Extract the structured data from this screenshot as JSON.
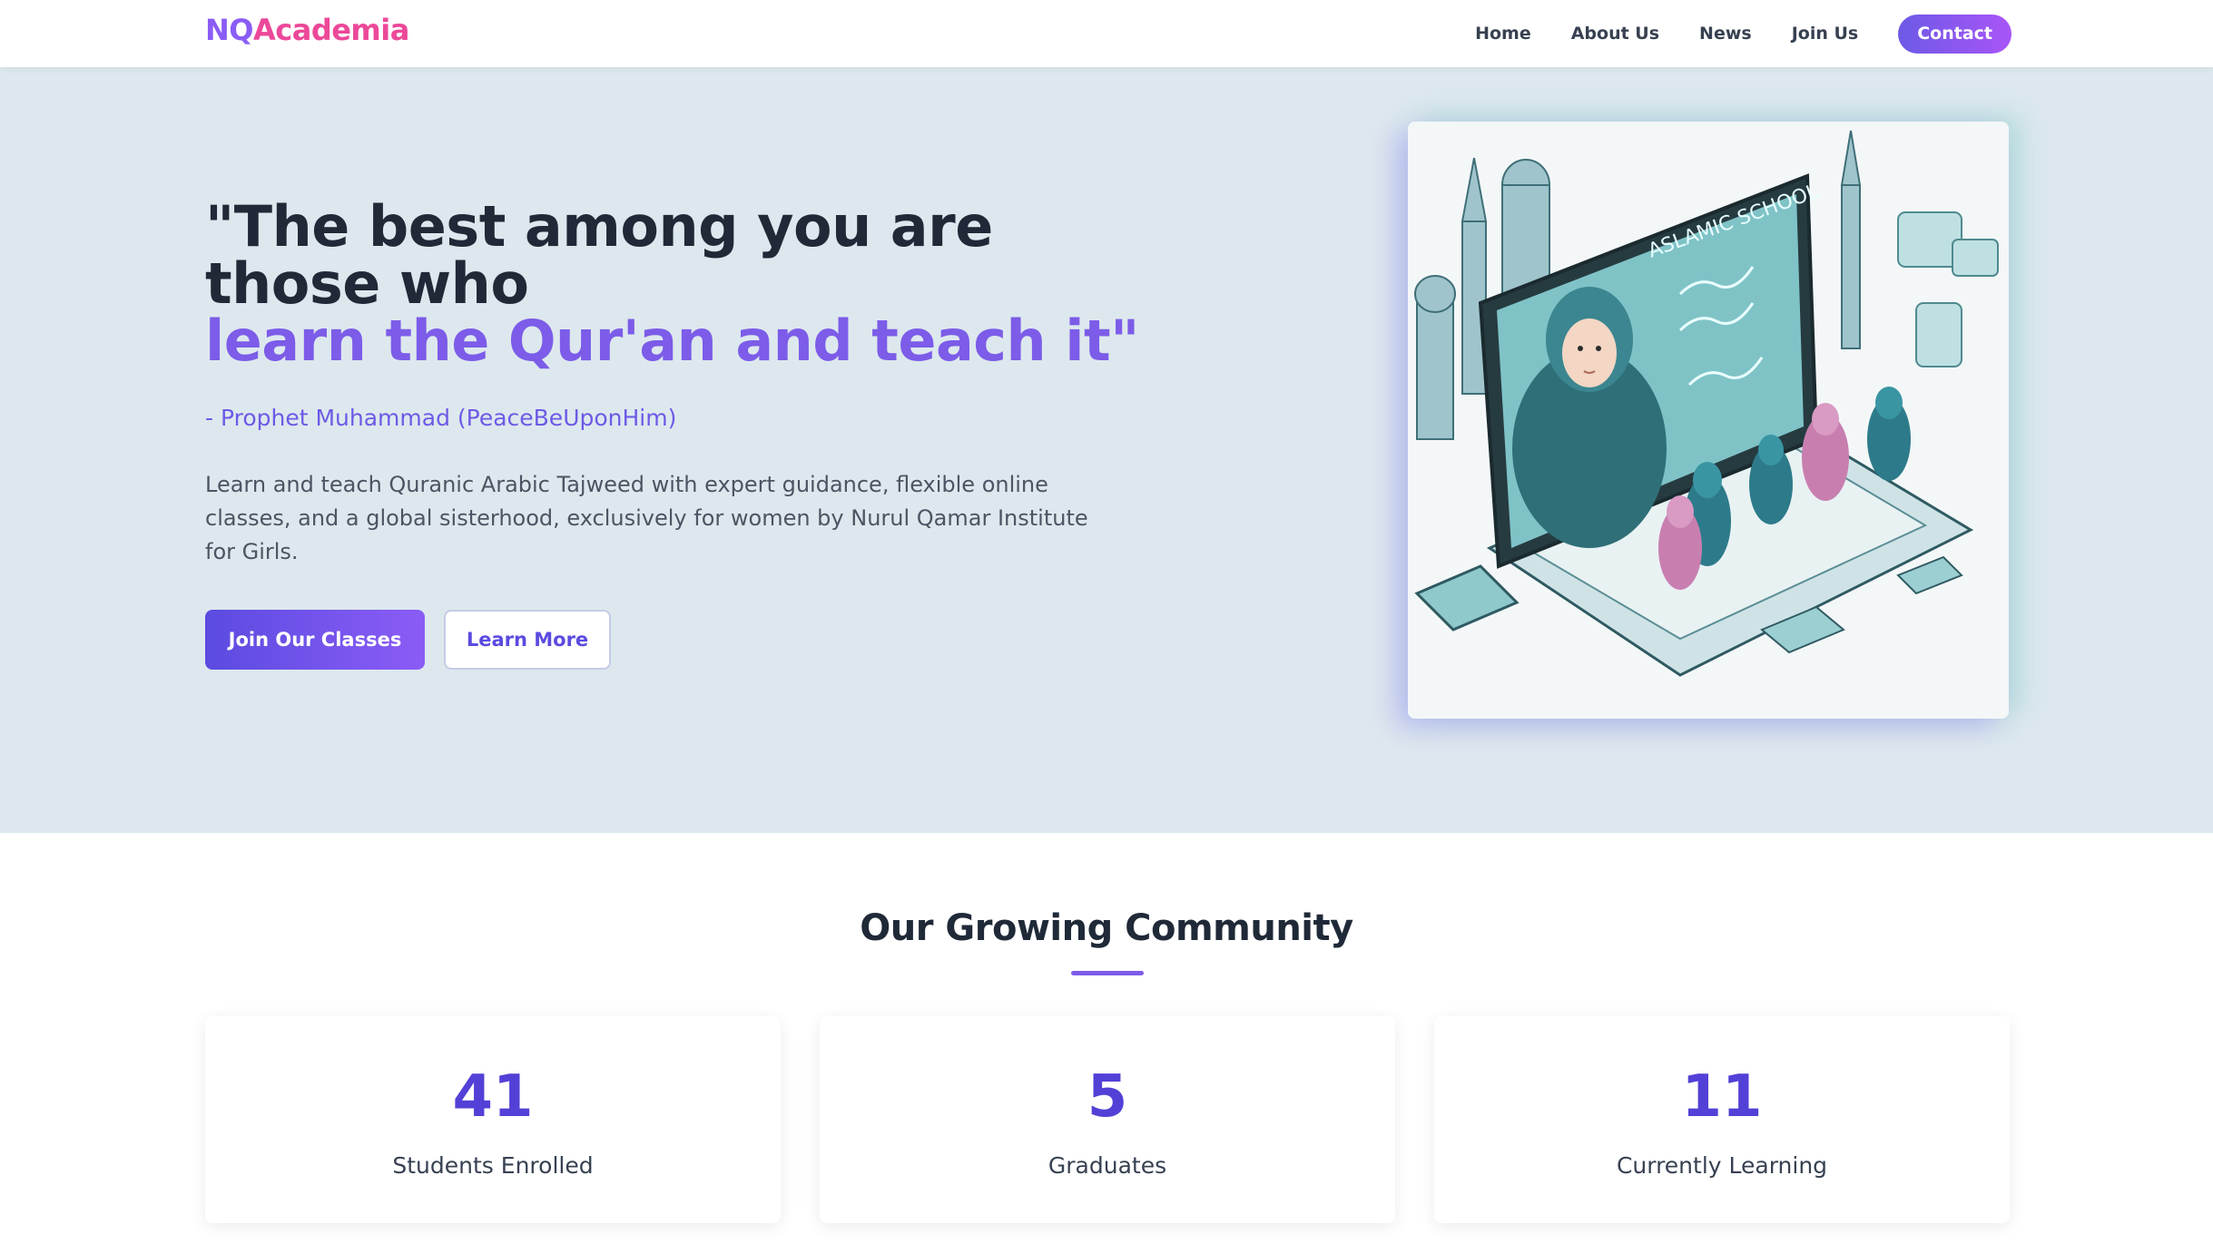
{
  "nav": {
    "logo_part1": "NQ",
    "logo_part2": "Academia",
    "links": [
      "Home",
      "About Us",
      "News",
      "Join Us"
    ],
    "contact_label": "Contact"
  },
  "hero": {
    "quote_line1": "\"The best among you are",
    "quote_line2": "those who",
    "quote_accent": "learn the Qur'an and teach it\"",
    "attribution": "- Prophet Muhammad (PeaceBeUponHim)",
    "description": "Learn and teach Quranic Arabic Tajweed with expert guidance, flexible online classes, and a global sisterhood, exclusively for women by Nurul Qamar Institute for Girls.",
    "primary_button": "Join Our Classes",
    "secondary_button": "Learn More",
    "image_screen_text": "ASLAMIC SCHOOL"
  },
  "community": {
    "title": "Our Growing Community",
    "stats": [
      {
        "value": "41",
        "label": "Students Enrolled"
      },
      {
        "value": "5",
        "label": "Graduates"
      },
      {
        "value": "11",
        "label": "Currently Learning"
      }
    ]
  },
  "colors": {
    "brand_purple": "#7c5ce8",
    "brand_pink": "#ec4899",
    "hero_bg": "#dde8ee",
    "stat_number": "#5340d6"
  }
}
